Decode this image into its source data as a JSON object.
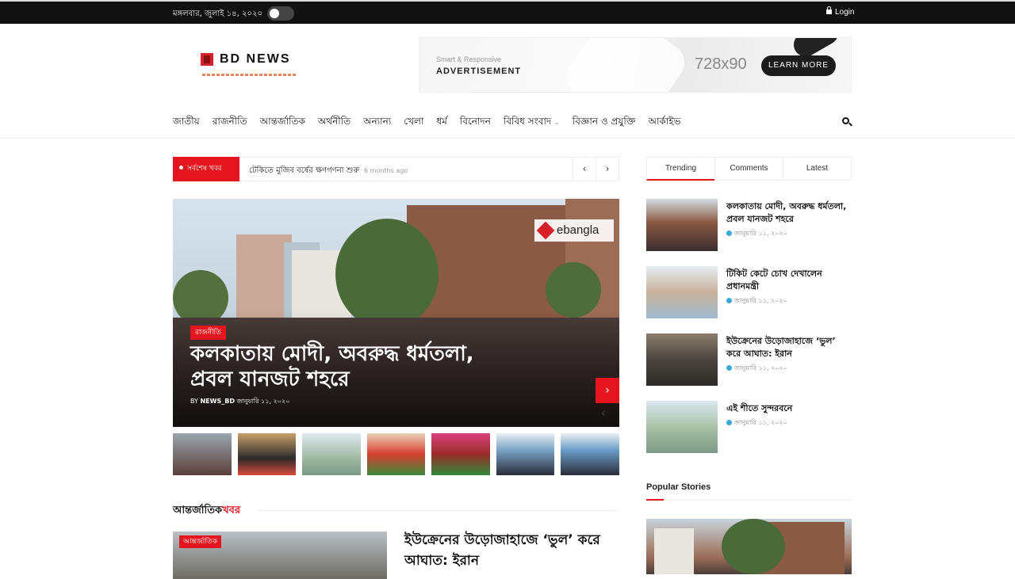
{
  "topbar": {
    "date": "মঙ্গলবার, জুলাই ১৪, ২০২০",
    "login": "Login"
  },
  "brand": {
    "name": "BD NEWS"
  },
  "ad": {
    "small": "Smart & Responsive",
    "title": "ADVERTISEMENT",
    "size": "728x90",
    "button": "LEARN MORE"
  },
  "nav": {
    "items": [
      {
        "label": "জাতীয়"
      },
      {
        "label": "রাজনীতি"
      },
      {
        "label": "আন্তর্জাতিক"
      },
      {
        "label": "অর্থনীতি"
      },
      {
        "label": "অন্যান্য"
      },
      {
        "label": "খেলা"
      },
      {
        "label": "ধর্ম"
      },
      {
        "label": "বিনোদন"
      },
      {
        "label": "বিবিধ সংবাদ"
      },
      {
        "label": "বিজ্ঞান ও প্রযুক্তি"
      },
      {
        "label": "আর্কাইভ"
      }
    ]
  },
  "ticker": {
    "label": "সর্বশেষ খবর",
    "text": "টেকিতে মুজিব বর্ষের ক্ষণগণনা শুরু",
    "time": "6 months ago",
    "prev": "‹",
    "next": "›"
  },
  "hero": {
    "category": "রাজনীতি",
    "title": "কলকাতায় মোদী, অবরুদ্ধ ধর্মতলা, প্রবল যানজট শহরে",
    "by": "BY",
    "author": "NEWS_BD",
    "date": "জানুয়ারি ১১, ২০২০",
    "source_logo": "ebangla",
    "next_arrow": "›",
    "prev_arrow": "‹"
  },
  "thumbnails": [
    {
      "label": "thumb-1"
    },
    {
      "label": "thumb-2"
    },
    {
      "label": "thumb-3"
    },
    {
      "label": "thumb-4"
    },
    {
      "label": "thumb-5"
    },
    {
      "label": "thumb-6"
    },
    {
      "label": "thumb-7"
    }
  ],
  "section": {
    "title_main": "আন্তর্জাতিক",
    "title_highlight": "খবর",
    "article_category": "আন্তর্জাতিক",
    "article_title": "ইউক্রেনের উড়োজাহাজে ‘ভুল’ করে আঘাত: ইরান"
  },
  "sidebar": {
    "tabs": [
      {
        "label": "Trending"
      },
      {
        "label": "Comments"
      },
      {
        "label": "Latest"
      }
    ],
    "items": [
      {
        "title": "কলকাতায় মোদী, অবরুদ্ধ ধর্মতলা, প্রবল যানজট শহরে",
        "date": "জানুয়ারি ১১, ২০২০"
      },
      {
        "title": "টিকিট কেটে চোখ দেখালেন প্রধানমন্ত্রী",
        "date": "জানুয়ারি ১১, ২০২০"
      },
      {
        "title": "ইউক্রেনের উড়োজাহাজে ‘ভুল’ করে আঘাত: ইরান",
        "date": "জানুয়ারি ১১, ২০২০"
      },
      {
        "title": "এই শীতে সুন্দরবনে",
        "date": "জানুয়ারি ১১, ২০২০"
      }
    ],
    "popular_title": "Popular Stories"
  },
  "colors": {
    "accent": "#e5151f",
    "topbar": "#111111"
  }
}
